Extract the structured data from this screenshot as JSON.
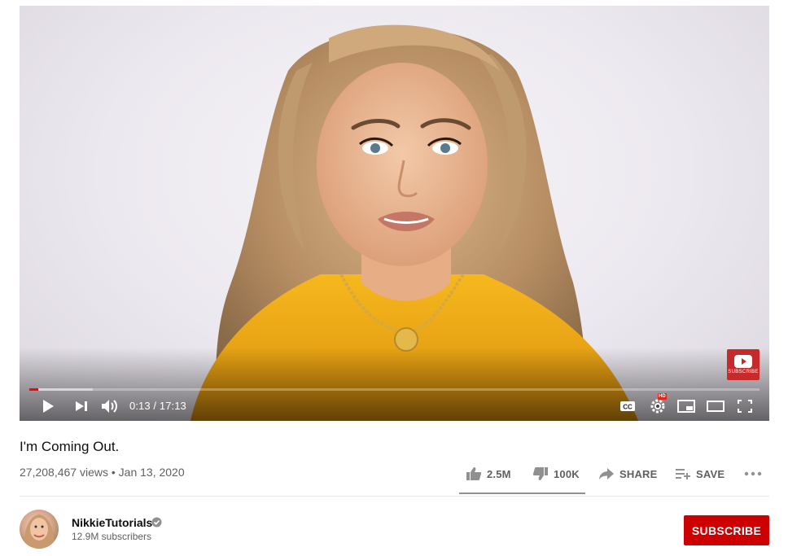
{
  "player": {
    "time_current": "0:13",
    "time_separator": "/",
    "time_total": "17:13",
    "progress_played": 0.0126,
    "progress_buffered": 0.087,
    "subscribe_watermark": "SUBSCRIBE",
    "hd_label": "HD",
    "controls": [
      "play-icon",
      "next-icon",
      "volume-icon",
      "captions-icon",
      "settings-icon",
      "miniplayer-icon",
      "theater-icon",
      "fullscreen-icon"
    ],
    "cc_label": "CC"
  },
  "video": {
    "title": "I'm Coming Out.",
    "views": "27,208,467 views",
    "dot": "•",
    "date": "Jan 13, 2020"
  },
  "actions": {
    "like_count": "2.5M",
    "dislike_count": "100K",
    "share_label": "SHARE",
    "save_label": "SAVE",
    "like_ratio": 0.96
  },
  "channel": {
    "name": "NikkieTutorials",
    "subscribers": "12.9M subscribers",
    "subscribe_label": "SUBSCRIBE"
  },
  "colors": {
    "accent_red": "#cc0000",
    "progress_red": "#ff0000",
    "shirt_yellow": "#f2b31c",
    "hair_blonde": "#c9a37a"
  }
}
